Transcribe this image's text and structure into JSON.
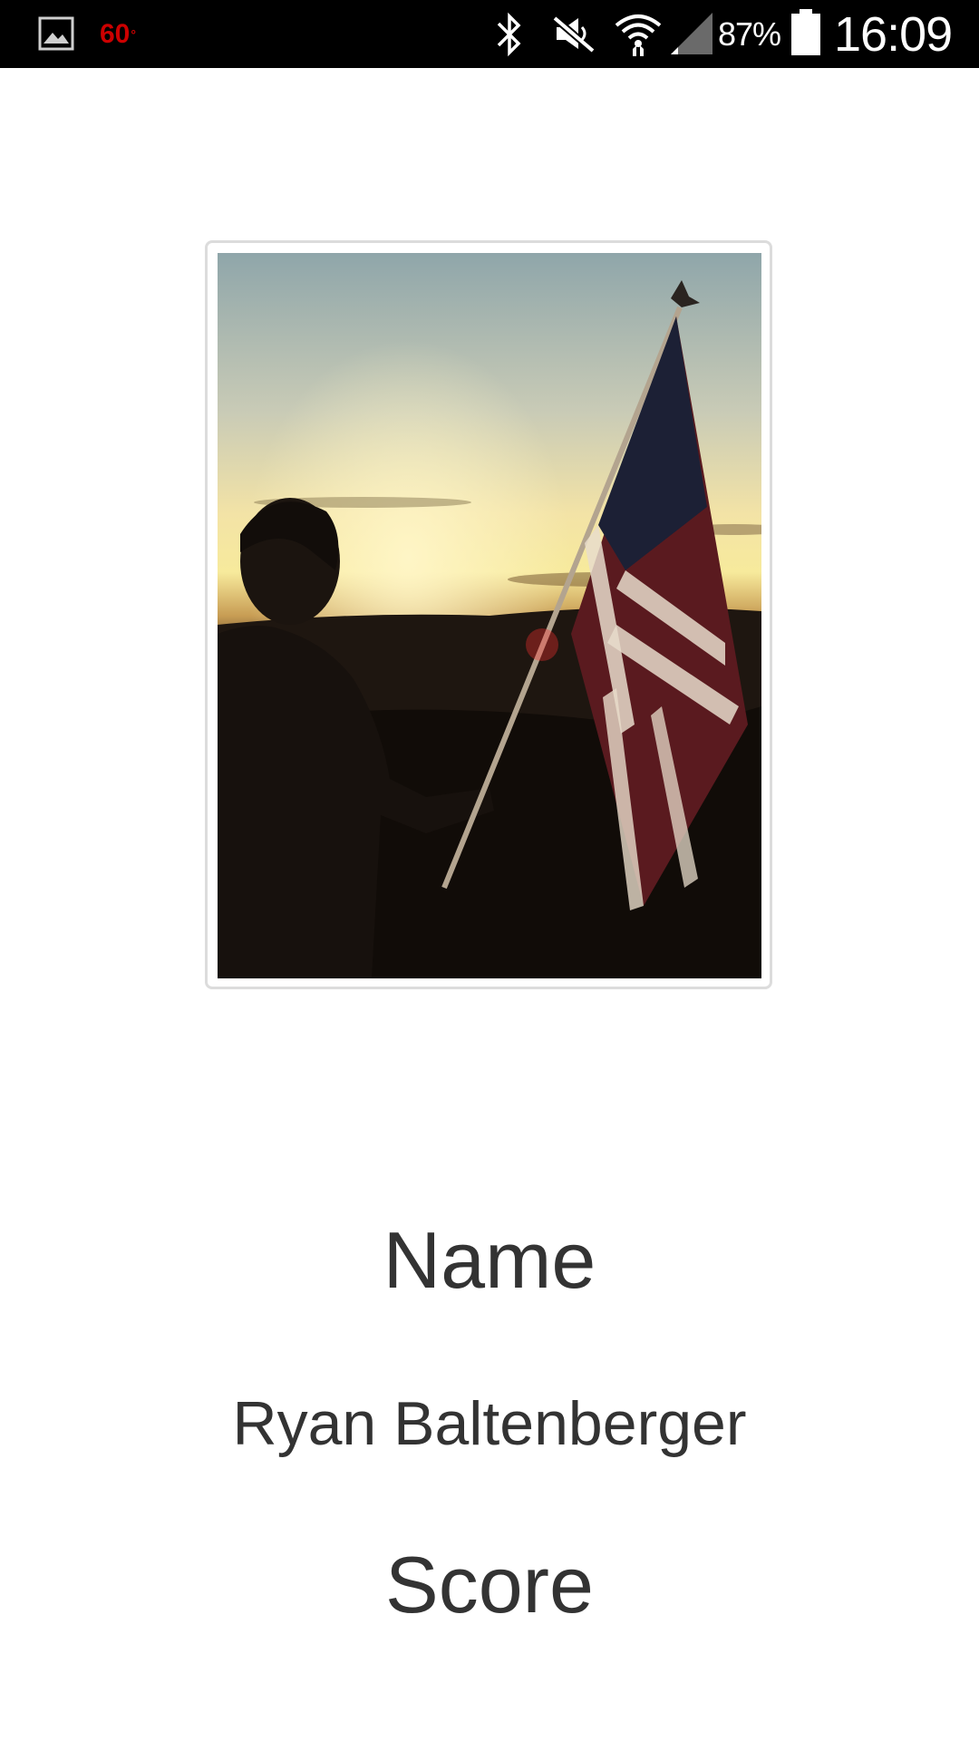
{
  "status_bar": {
    "icons_left": [
      "gallery-icon"
    ],
    "temperature": "60",
    "temperature_unit_mark": "°",
    "icons_right": [
      "bluetooth-icon",
      "mute-icon",
      "wifi-icon",
      "signal-icon",
      "battery-icon"
    ],
    "battery_percent": "87%",
    "time": "16:09"
  },
  "profile": {
    "photo_description_icon": "profile-photo",
    "name_heading": "Name",
    "name_value": "Ryan Baltenberger",
    "score_heading": "Score"
  },
  "colors": {
    "status_bar_bg": "#000000",
    "temperature": "#cc0000",
    "text": "#333333",
    "card_border": "#dcdcdc"
  }
}
